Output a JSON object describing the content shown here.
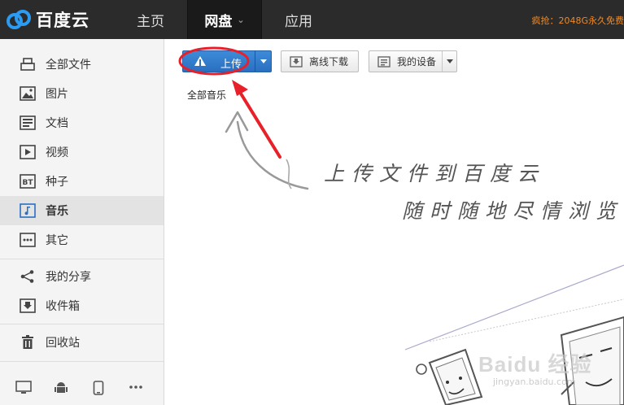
{
  "header": {
    "logo_text": "百度云",
    "tabs": [
      {
        "label": "主页"
      },
      {
        "label": "网盘"
      },
      {
        "label": "应用"
      }
    ],
    "promo": "疯抢：2048G永久免费"
  },
  "sidebar": {
    "items": [
      {
        "label": "全部文件",
        "icon": "folder-stack-icon"
      },
      {
        "label": "图片",
        "icon": "image-icon"
      },
      {
        "label": "文档",
        "icon": "document-icon"
      },
      {
        "label": "视频",
        "icon": "video-icon"
      },
      {
        "label": "种子",
        "icon": "bt-icon"
      },
      {
        "label": "音乐",
        "icon": "music-icon"
      },
      {
        "label": "其它",
        "icon": "more-icon"
      },
      {
        "label": "我的分享",
        "icon": "share-icon"
      },
      {
        "label": "收件箱",
        "icon": "inbox-icon"
      },
      {
        "label": "回收站",
        "icon": "trash-icon"
      }
    ],
    "device_icons": [
      "desktop-icon",
      "android-icon",
      "phone-icon",
      "more-dots-icon"
    ]
  },
  "toolbar": {
    "upload_label": "上传",
    "offline_label": "离线下载",
    "devices_label": "我的设备"
  },
  "breadcrumb": "全部音乐",
  "empty_state": {
    "line1": "上传文件到百度云",
    "line2": "随时随地尽情浏览"
  },
  "watermark": {
    "logo": "Baidu 经验",
    "sub": "jingyan.baidu.com"
  },
  "colors": {
    "topbar": "#2b2b2b",
    "upload_blue": "#2a6fc1",
    "annotation_red": "#e8202a",
    "promo_orange": "#f08a24"
  }
}
